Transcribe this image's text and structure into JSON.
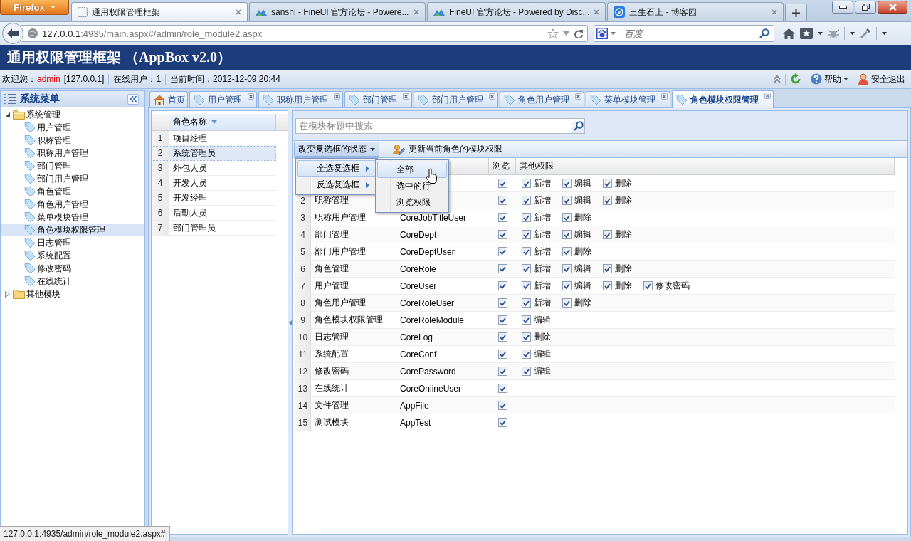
{
  "browser": {
    "menu_button": "Firefox",
    "tabs": [
      {
        "title": "通用权限管理框架",
        "kind": "blank",
        "selected": true
      },
      {
        "title": "sanshi - FineUI 官方论坛 - Powere...",
        "kind": "fineui",
        "selected": false
      },
      {
        "title": "FineUI 官方论坛 - Powered by Disc...",
        "kind": "fineui",
        "selected": false
      },
      {
        "title": "三生石上 - 博客园",
        "kind": "blog",
        "selected": false
      }
    ],
    "address": {
      "host": "127.0.0.1",
      "path": ":4935/main.aspx#/admin/role_module2.aspx"
    },
    "search": {
      "placeholder": "百度"
    }
  },
  "header": {
    "title": "通用权限管理框架 （AppBox v2.0）"
  },
  "info_bar": {
    "welcome": "欢迎您：",
    "user": "admin",
    "ip": "[127.0.0.1]",
    "online": "在线用户：1",
    "time": "当前时间：2012-12-09 20:44",
    "help": "帮助",
    "logout": "安全退出"
  },
  "sidebar": {
    "title": "系统菜单",
    "tree": [
      {
        "label": "系统管理",
        "expanded": true,
        "selected": false,
        "children": [
          {
            "label": "用户管理",
            "selected": false
          },
          {
            "label": "职称管理",
            "selected": false
          },
          {
            "label": "职称用户管理",
            "selected": false
          },
          {
            "label": "部门管理",
            "selected": false
          },
          {
            "label": "部门用户管理",
            "selected": false
          },
          {
            "label": "角色管理",
            "selected": false
          },
          {
            "label": "角色用户管理",
            "selected": false
          },
          {
            "label": "菜单模块管理",
            "selected": false
          },
          {
            "label": "角色模块权限管理",
            "selected": true
          },
          {
            "label": "日志管理",
            "selected": false
          },
          {
            "label": "系统配置",
            "selected": false
          },
          {
            "label": "修改密码",
            "selected": false
          },
          {
            "label": "在线统计",
            "selected": false
          }
        ]
      },
      {
        "label": "其他模块",
        "expanded": false,
        "selected": false
      }
    ]
  },
  "tabs": [
    {
      "label": "首页",
      "kind": "home",
      "selected": false
    },
    {
      "label": "用户管理",
      "kind": "page",
      "selected": false
    },
    {
      "label": "职称用户管理",
      "kind": "page",
      "selected": false
    },
    {
      "label": "部门管理",
      "kind": "page",
      "selected": false
    },
    {
      "label": "部门用户管理",
      "kind": "page",
      "selected": false
    },
    {
      "label": "角色用户管理",
      "kind": "page",
      "selected": false
    },
    {
      "label": "菜单模块管理",
      "kind": "page",
      "selected": false
    },
    {
      "label": "角色模块权限管理",
      "kind": "page",
      "selected": true
    }
  ],
  "roles": {
    "column": "角色名称",
    "rows": [
      {
        "index": "1",
        "name": "项目经理",
        "selected": false
      },
      {
        "index": "2",
        "name": "系统管理员",
        "selected": true
      },
      {
        "index": "3",
        "name": "外包人员",
        "selected": false
      },
      {
        "index": "4",
        "name": "开发人员",
        "selected": false
      },
      {
        "index": "5",
        "name": "开发经理",
        "selected": false
      },
      {
        "index": "6",
        "name": "后勤人员",
        "selected": false
      },
      {
        "index": "7",
        "name": "部门管理员",
        "selected": false
      }
    ]
  },
  "search": {
    "placeholder": "在模块标题中搜索"
  },
  "actions": [
    {
      "label": "改变复选框的状态",
      "kind": "menu",
      "pressed": true
    },
    {
      "label": "更新当前角色的模块权限",
      "kind": "save",
      "pressed": false
    }
  ],
  "menu": {
    "items": [
      {
        "label": "全选复选框",
        "selected": true
      },
      {
        "label": "反选复选框",
        "selected": false
      }
    ],
    "submenu": [
      {
        "label": "全部",
        "selected": true
      },
      {
        "label": "选中的行",
        "selected": false
      },
      {
        "label": "浏览权限",
        "selected": false
      }
    ]
  },
  "grid": {
    "columns": {
      "browse": "浏览",
      "permissions": "其他权限"
    },
    "rows": [
      {
        "browse": true,
        "permissions": [
          {
            "label": "新增",
            "checked": true
          },
          {
            "label": "编辑",
            "checked": true
          },
          {
            "label": "删除",
            "checked": true
          }
        ]
      },
      {
        "index": "2",
        "name": "职称管理",
        "browse": true,
        "permissions": [
          {
            "label": "新增",
            "checked": true
          },
          {
            "label": "编辑",
            "checked": true
          },
          {
            "label": "删除",
            "checked": true
          }
        ]
      },
      {
        "index": "3",
        "name": "职称用户管理",
        "code": "CoreJobTitleUser",
        "browse": true,
        "permissions": [
          {
            "label": "新增",
            "checked": true
          },
          {
            "label": "删除",
            "checked": true
          }
        ]
      },
      {
        "index": "4",
        "name": "部门管理",
        "code": "CoreDept",
        "browse": true,
        "permissions": [
          {
            "label": "新增",
            "checked": true
          },
          {
            "label": "编辑",
            "checked": true
          },
          {
            "label": "删除",
            "checked": true
          }
        ]
      },
      {
        "index": "5",
        "name": "部门用户管理",
        "code": "CoreDeptUser",
        "browse": true,
        "permissions": [
          {
            "label": "新增",
            "checked": true
          },
          {
            "label": "删除",
            "checked": true
          }
        ]
      },
      {
        "index": "6",
        "name": "角色管理",
        "code": "CoreRole",
        "browse": true,
        "permissions": [
          {
            "label": "新增",
            "checked": true
          },
          {
            "label": "编辑",
            "checked": true
          },
          {
            "label": "删除",
            "checked": true
          }
        ]
      },
      {
        "index": "7",
        "name": "用户管理",
        "code": "CoreUser",
        "browse": true,
        "permissions": [
          {
            "label": "新增",
            "checked": true
          },
          {
            "label": "编辑",
            "checked": true
          },
          {
            "label": "删除",
            "checked": true
          },
          {
            "label": "修改密码",
            "checked": true
          }
        ]
      },
      {
        "index": "8",
        "name": "角色用户管理",
        "code": "CoreRoleUser",
        "browse": true,
        "permissions": [
          {
            "label": "新增",
            "checked": true
          },
          {
            "label": "删除",
            "checked": true
          }
        ]
      },
      {
        "index": "9",
        "name": "角色模块权限管理",
        "code": "CoreRoleModule",
        "browse": true,
        "permissions": [
          {
            "label": "编辑",
            "checked": true
          }
        ]
      },
      {
        "index": "10",
        "name": "日志管理",
        "code": "CoreLog",
        "browse": true,
        "permissions": [
          {
            "label": "删除",
            "checked": true
          }
        ]
      },
      {
        "index": "11",
        "name": "系统配置",
        "code": "CoreConf",
        "browse": true,
        "permissions": [
          {
            "label": "编辑",
            "checked": true
          }
        ]
      },
      {
        "index": "12",
        "name": "修改密码",
        "code": "CorePassword",
        "browse": true,
        "permissions": [
          {
            "label": "编辑",
            "checked": true
          }
        ]
      },
      {
        "index": "13",
        "name": "在线统计",
        "code": "CoreOnlineUser",
        "browse": true
      },
      {
        "index": "14",
        "name": "文件管理",
        "code": "AppFile",
        "browse": true
      },
      {
        "index": "15",
        "name": "测试模块",
        "code": "AppTest",
        "browse": true
      }
    ]
  },
  "status_text": "127.0.0.1:4935/admin/role_module2.aspx#"
}
